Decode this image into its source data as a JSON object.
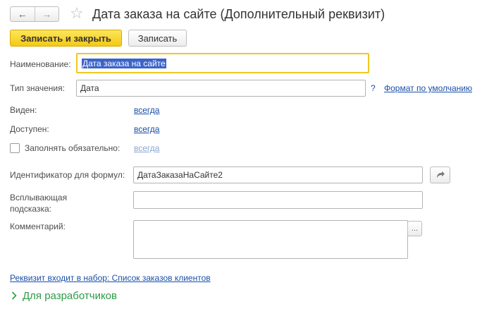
{
  "header": {
    "title": "Дата заказа на сайте (Дополнительный реквизит)",
    "back_icon": "←",
    "forward_icon": "→",
    "star_icon": "☆"
  },
  "toolbar": {
    "save_close_label": "Записать и закрыть",
    "save_label": "Записать"
  },
  "form": {
    "name_label": "Наименование:",
    "name_value": "Дата заказа на сайте",
    "type_label": "Тип значения:",
    "type_value": "Дата",
    "type_help": "?",
    "default_format_link": "Формат по умолчанию",
    "visible_label": "Виден:",
    "visible_value": "всегда",
    "available_label": "Доступен:",
    "available_value": "всегда",
    "required_label": "Заполнять обязательно:",
    "required_value": "всегда",
    "formula_id_label": "Идентификатор для формул:",
    "formula_id_value": "ДатаЗаказаНаСайте2",
    "tooltip_label_line1": "Всплывающая",
    "tooltip_label_line2": "подсказка:",
    "tooltip_value": "",
    "comment_label": "Комментарий:",
    "comment_value": "",
    "comment_more": "...",
    "set_link": "Реквизит входит в набор: Список заказов клиентов",
    "dev_section": "Для разработчиков"
  },
  "colors": {
    "primary_button": "#f5c913",
    "link": "#1a4fa8",
    "dev_section": "#2e9b48",
    "focus_border": "#f0c820"
  }
}
